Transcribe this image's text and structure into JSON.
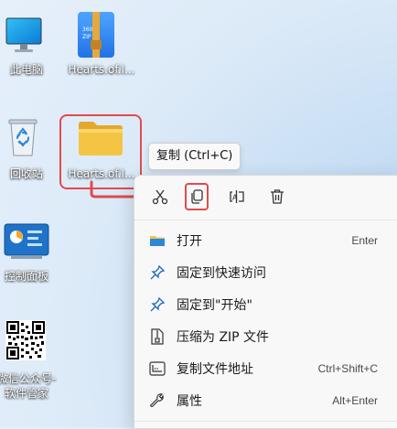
{
  "desktop": {
    "icons": [
      {
        "label": "此电脑"
      },
      {
        "label": "Hearts.of.I..."
      },
      {
        "label": "回收站"
      },
      {
        "label": "Hearts.of.I..."
      },
      {
        "label": "控制面板"
      },
      {
        "label": "微信公众号-"
      },
      {
        "label": "软件管家"
      }
    ],
    "zip_badge": "360\nZIP"
  },
  "tooltip": {
    "text": "复制 (Ctrl+C)"
  },
  "context_menu": {
    "toolbar": [
      {
        "name": "cut",
        "icon": "scissors-icon"
      },
      {
        "name": "copy",
        "icon": "copy-icon"
      },
      {
        "name": "rename",
        "icon": "rename-icon"
      },
      {
        "name": "delete",
        "icon": "trash-icon"
      }
    ],
    "items": [
      {
        "label": "打开",
        "shortcut": "Enter",
        "icon": "folder-icon"
      },
      {
        "label": "固定到快速访问",
        "shortcut": "",
        "icon": "pin-icon"
      },
      {
        "label": "固定到\"开始\"",
        "shortcut": "",
        "icon": "pin-icon"
      },
      {
        "label": "压缩为 ZIP 文件",
        "shortcut": "",
        "icon": "zip-icon"
      },
      {
        "label": "复制文件地址",
        "shortcut": "Ctrl+Shift+C",
        "icon": "path-icon"
      },
      {
        "label": "属性",
        "shortcut": "Alt+Enter",
        "icon": "wrench-icon"
      }
    ]
  },
  "colors": {
    "highlight": "#e14b4b",
    "folder": "#f6c445"
  }
}
